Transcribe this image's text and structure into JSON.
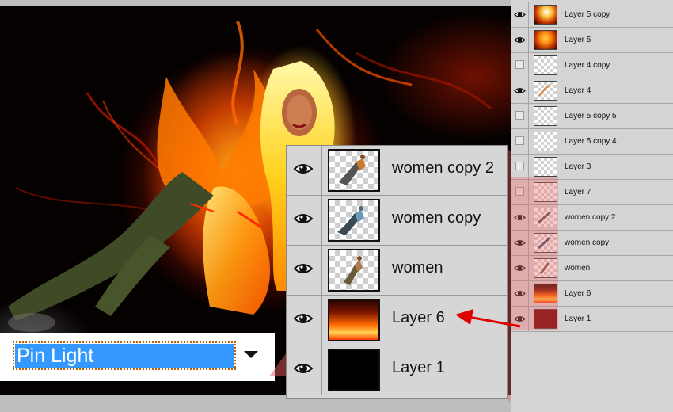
{
  "blend_mode": {
    "value": "Pin Light"
  },
  "zoom_layers": [
    {
      "name": "women copy 2",
      "visible": true,
      "thumb": "women"
    },
    {
      "name": "women copy",
      "visible": true,
      "thumb": "women"
    },
    {
      "name": "women",
      "visible": true,
      "thumb": "women"
    },
    {
      "name": "Layer 6",
      "visible": true,
      "thumb": "fire"
    },
    {
      "name": "Layer 1",
      "visible": true,
      "thumb": "black"
    }
  ],
  "layers": [
    {
      "name": "Layer 5 copy",
      "visible": true,
      "thumb": "fire5"
    },
    {
      "name": "Layer 5",
      "visible": true,
      "thumb": "fire5b"
    },
    {
      "name": "Layer 4 copy",
      "visible": false,
      "thumb": "empty"
    },
    {
      "name": "Layer 4",
      "visible": true,
      "thumb": "sparks"
    },
    {
      "name": "Layer 5 copy 5",
      "visible": false,
      "thumb": "empty"
    },
    {
      "name": "Layer 5 copy 4",
      "visible": false,
      "thumb": "empty"
    },
    {
      "name": "Layer 3",
      "visible": false,
      "thumb": "empty"
    },
    {
      "name": "Layer 7",
      "visible": false,
      "thumb": "empty"
    },
    {
      "name": "women copy 2",
      "visible": true,
      "thumb": "women"
    },
    {
      "name": "women copy",
      "visible": true,
      "thumb": "women"
    },
    {
      "name": "women",
      "visible": true,
      "thumb": "women"
    },
    {
      "name": "Layer 6",
      "visible": true,
      "thumb": "fire"
    },
    {
      "name": "Layer 1",
      "visible": true,
      "thumb": "darkred"
    }
  ],
  "icons": {
    "visibility": "eye-icon",
    "hidden": "empty-visibility-box",
    "dropdown": "triangle-down-icon",
    "annotation": "red-arrow"
  },
  "colors": {
    "selection_blue": "#3399ff",
    "annotation_red": "#e00000",
    "panel_gray": "#d4d4d4"
  }
}
